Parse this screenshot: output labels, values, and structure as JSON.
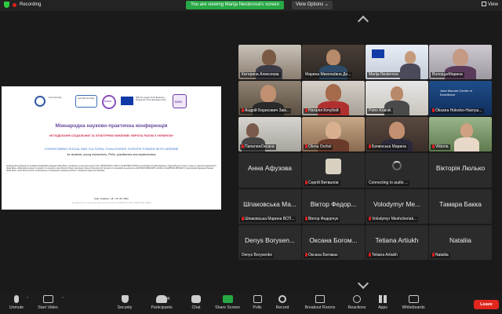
{
  "top": {
    "recording": "Recording",
    "viewing_banner": "You are viewing Marija Nesterova's screen",
    "view_options": "View Options ⌄",
    "view": "View"
  },
  "slide": {
    "logo_texts": [
      "Jean Monnet Chair",
      "With the support of the Erasmus+ Programme of the European Union",
      "DISED",
      "DGO"
    ],
    "title": "Міжнародна науково-практична конференція",
    "ukrainian_title": "«В ПОДОЛАННІ СОЦІАЛЬНИХ ТА КУЛЬТУРНИХ ВИКЛИКІВ: ЄВРОПА РАЗОМ З УКРАЇНОЮ»",
    "english_title": "«OVERCOMING SOCIAL AND CULTURAL CHALLENGES: EUROPE STANDS WITH UKRAINE",
    "subtitle": "for students, young researchers, PhDs, practitioners and academicians",
    "paragraph": "Конференція проводиться в рамках інноваційної кафедри Жана Моне «Соціальні та культурні цінності ЄС» (620433-EPP-1-2020-1-UA-EPPJMO-CHAIR) за підтримки програми Еразмус+ Європейського Союзу, спільно з Центром досконалості Жана Моне «Європейські цінності розмаїття та інклюзії» (Jean Monnet Project «European values of diversity and inclusion for sustainable development» (EVISSD) 610503-EPP-1-2019-1-UA-EPPJMO-PROJECT), Центром Дослідницької Мережі Жана Моне «Jean Monnet Centre of Excellence» та Кафедрою соціальної роботи і соціальної педагогіки (Україна)",
    "city_date": "Київ, Україна  •  18 - 19. 05. 2022",
    "footer": "Jean Monnet Chair «Social and cultural values of the EU» (620433-EPP-1-2020-1-UA-EPPJMO-CHAIR)"
  },
  "tiles": [
    {
      "name": "Катерина Алексеєва",
      "muted": false
    },
    {
      "name": "Марина Миколаївна Де...",
      "muted": false
    },
    {
      "name": "Marija Nesterova",
      "muted": false
    },
    {
      "name": "ВолощукМарина",
      "muted": false
    },
    {
      "name": "Андрій Борисович Зам...",
      "muted": true
    },
    {
      "name": "Наталія Кочубей",
      "muted": true
    },
    {
      "name": "Petro Kralnik",
      "muted": false
    },
    {
      "name": "Oksana Holovko-Havryш...",
      "muted": true
    },
    {
      "name": "ПапилюкОксана",
      "muted": true
    },
    {
      "name": "Olena Orzhel",
      "muted": true
    },
    {
      "name": "Бачинська Марина",
      "muted": true
    },
    {
      "name": "Viktoria",
      "muted": true
    },
    {
      "name": "Анна Афузова",
      "big": "Анна Афузова",
      "muted": false
    },
    {
      "name": "Сергій Витвалов",
      "muted": true
    },
    {
      "name": "Connecting to audio ...",
      "muted": false
    },
    {
      "name": "Вікторія Люлько",
      "big": "Вікторія Люлько",
      "muted": false
    },
    {
      "name": "Шпаковська Марина ВСП...",
      "big": "Шпаковська Ма...",
      "muted": true
    },
    {
      "name": "Віктор Федорчук",
      "big": "Віктор Федор...",
      "muted": true
    },
    {
      "name": "Volodymyr Meshcheriak...",
      "big": "Volodymyr Me...",
      "muted": true
    },
    {
      "name": "Тамара Бакка",
      "big": "Тамара Бакка",
      "muted": true
    },
    {
      "name": "Denys Borysenko",
      "big": "Denys Borysen...",
      "muted": false
    },
    {
      "name": "Оксана Богомаз",
      "big": "Оксана Богом...",
      "muted": true
    },
    {
      "name": "Tetiana Artiukh",
      "big": "Tetiana Artiukh",
      "muted": true
    },
    {
      "name": "Nataliia",
      "big": "Nataliia",
      "muted": true
    }
  ],
  "toolbar": {
    "unmute": "Unmute",
    "start_video": "Start Video",
    "security": "Security",
    "participants": "Participants",
    "participants_count": "34",
    "chat": "Chat",
    "share_screen": "Share Screen",
    "polls": "Polls",
    "record": "Record",
    "breakout_rooms": "Breakout Rooms",
    "reactions": "Reactions",
    "apps": "Apps",
    "whiteboards": "Whiteboards",
    "leave": "Leave"
  },
  "colors": {
    "accent_green": "#27a845",
    "leave_red": "#e0261d",
    "muted_red": "#e02020"
  }
}
